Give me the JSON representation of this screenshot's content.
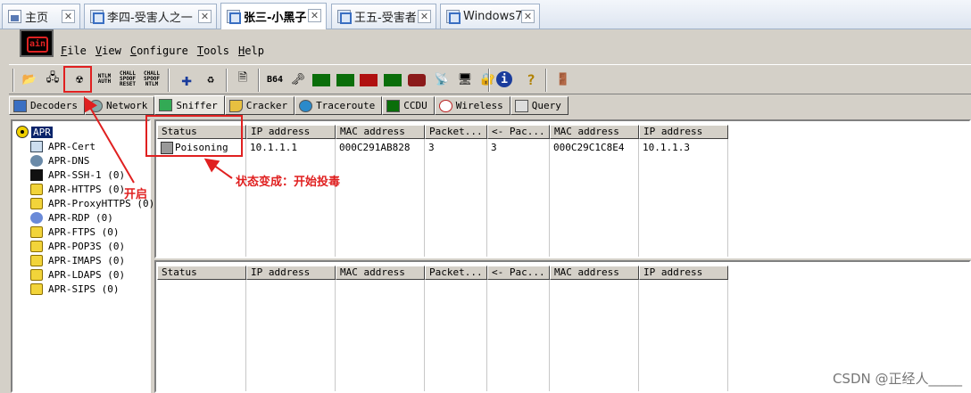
{
  "vm_tabs": [
    {
      "label": "主页",
      "icon": "home-icon"
    },
    {
      "label": "李四-受害人之一",
      "icon": "vm-window-icon"
    },
    {
      "label": "张三-小黑子",
      "icon": "vm-window-icon",
      "active": true
    },
    {
      "label": "王五-受害者",
      "icon": "vm-window-icon"
    },
    {
      "label": "Windows7",
      "icon": "vm-window-icon"
    }
  ],
  "app": {
    "logo_text": "ain"
  },
  "menu": [
    "File",
    "View",
    "Configure",
    "Tools",
    "Help"
  ],
  "toolbar": {
    "ntlm_auth": "NTLM AUTH",
    "chall_spoof_reset": "CHALL SPOOF RESET",
    "chall_spoof_ntlm": "CHALL SPOOF NTLM",
    "b64": "B64"
  },
  "main_tabs": [
    "Decoders",
    "Network",
    "Sniffer",
    "Cracker",
    "Traceroute",
    "CCDU",
    "Wireless",
    "Query"
  ],
  "tree": {
    "root": "APR",
    "items": [
      "APR-Cert",
      "APR-DNS",
      "APR-SSH-1  (0)",
      "APR-HTTPS  (0)",
      "APR-ProxyHTTPS  (0)",
      "APR-RDP  (0)",
      "APR-FTPS  (0)",
      "APR-POP3S  (0)",
      "APR-IMAPS  (0)",
      "APR-LDAPS  (0)",
      "APR-SIPS  (0)"
    ]
  },
  "grid_top": {
    "columns": [
      "Status",
      "IP address",
      "MAC address",
      "Packet...",
      "<- Pac...",
      "MAC address",
      "IP address"
    ],
    "rows": [
      [
        "Poisoning",
        "10.1.1.1",
        "000C291AB828",
        "3",
        "3",
        "000C29C1C8E4",
        "10.1.1.3"
      ]
    ]
  },
  "grid_bottom": {
    "columns": [
      "Status",
      "IP address",
      "MAC address",
      "Packet...",
      "<- Pac...",
      "MAC address",
      "IP address"
    ]
  },
  "annotations": {
    "start": "开启",
    "status_change": "状态变成：开始投毒"
  },
  "watermark": "CSDN @正经人_____"
}
